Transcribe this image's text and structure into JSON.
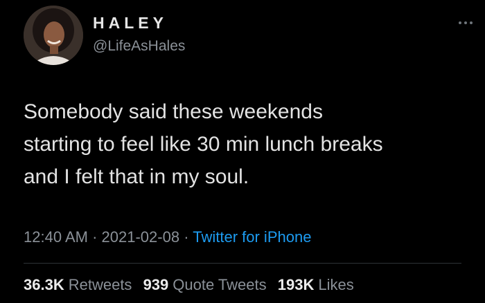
{
  "tweet": {
    "author": {
      "display_name": "HALEY",
      "handle": "@LifeAsHales",
      "avatar_icon": "profile-photo"
    },
    "more_icon": "ellipsis-icon",
    "text_lines": [
      "Somebody said these weekends",
      "starting to feel like 30 min lunch breaks",
      "and I felt that in my soul."
    ],
    "meta": {
      "time": "12:40 AM",
      "separator": "·",
      "date": "2021-02-08",
      "source": "Twitter for iPhone"
    },
    "stats": {
      "retweets_count": "36.3K",
      "retweets_label": "Retweets",
      "quotes_count": "939",
      "quotes_label": "Quote Tweets",
      "likes_count": "193K",
      "likes_label": "Likes"
    }
  },
  "colors": {
    "background": "#000000",
    "text": "#e3e3e3",
    "secondary": "#8b9198",
    "link": "#1d9bf0",
    "divider": "#2f3336"
  }
}
